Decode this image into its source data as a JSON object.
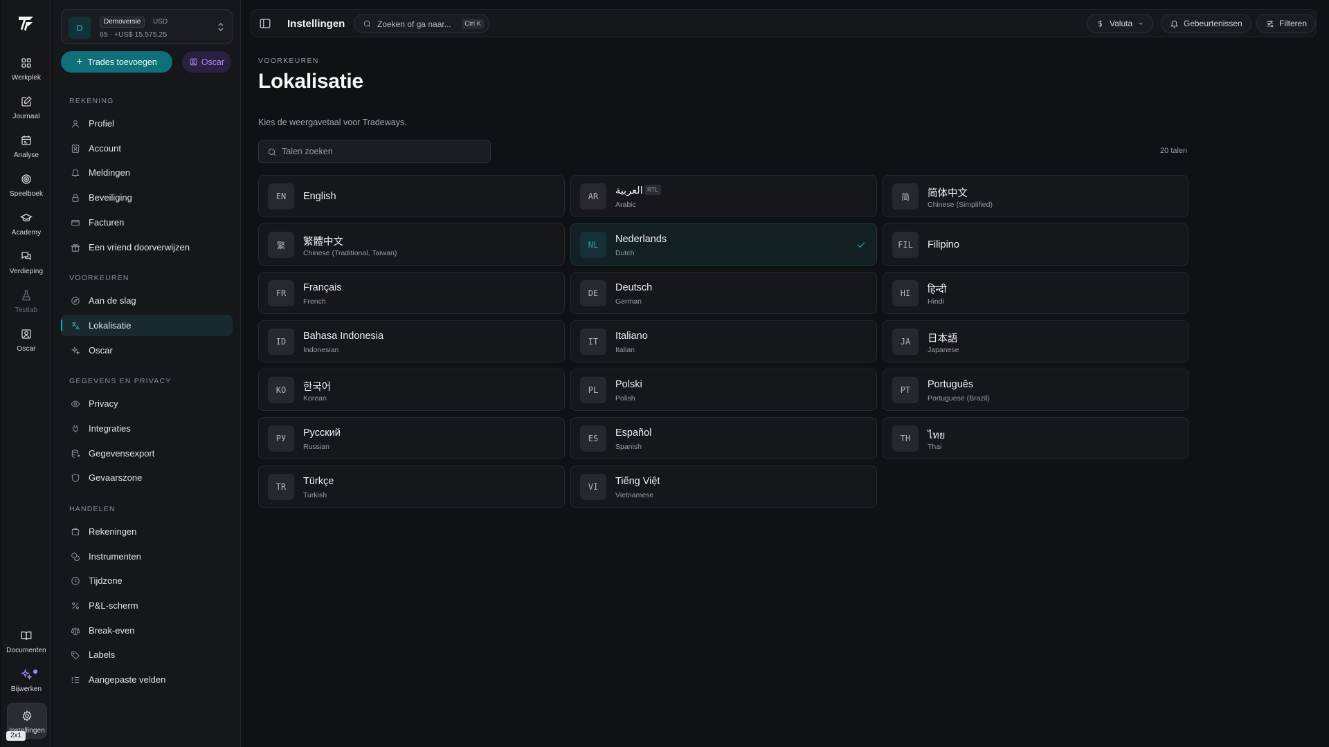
{
  "rail": {
    "items": [
      {
        "label": "Werkplek",
        "icon": "grid-icon"
      },
      {
        "label": "Journaal",
        "icon": "journal-edit-icon"
      },
      {
        "label": "Analyse",
        "icon": "calendar-icon"
      },
      {
        "label": "Speelboek",
        "icon": "target-icon"
      },
      {
        "label": "Academy",
        "icon": "graduation-cap-icon"
      },
      {
        "label": "Verdieping",
        "icon": "chat-bubbles-icon"
      },
      {
        "label": "Testlab",
        "icon": "flask-icon"
      },
      {
        "label": "Oscar",
        "icon": "user-square-icon"
      }
    ],
    "bottom": [
      {
        "label": "Documenten",
        "icon": "book-open-icon"
      },
      {
        "label": "Bijwerken",
        "icon": "sparkles-icon"
      },
      {
        "label": "Instellingen",
        "icon": "gear-icon"
      }
    ],
    "zoom_tag": "2x1"
  },
  "account": {
    "avatar": "D",
    "badge": "Demoversie",
    "currency": "USD",
    "balance": "65 · +US$ 15.575,25"
  },
  "actions": {
    "add_trades": "Trades toevoegen",
    "oscar": "Oscar"
  },
  "sidebar": {
    "sections": [
      {
        "title": "REKENING",
        "items": [
          "Profiel",
          "Account",
          "Meldingen",
          "Beveiliging",
          "Facturen",
          "Een vriend doorverwijzen"
        ]
      },
      {
        "title": "VOORKEUREN",
        "items": [
          "Aan de slag",
          "Lokalisatie",
          "Oscar"
        ]
      },
      {
        "title": "GEGEVENS EN PRIVACY",
        "items": [
          "Privacy",
          "Integraties",
          "Gegevensexport",
          "Gevaarszone"
        ]
      },
      {
        "title": "HANDELEN",
        "items": [
          "Rekeningen",
          "Instrumenten",
          "Tijdzone",
          "P&L-scherm",
          "Break-even",
          "Labels",
          "Aangepaste velden"
        ]
      }
    ],
    "active": "Lokalisatie"
  },
  "topbar": {
    "title": "Instellingen",
    "search_placeholder": "Zoeken of ga naar...",
    "shortcut": "Ctrl K",
    "currency_button": "Valuta",
    "events_button": "Gebeurtenissen",
    "filter_button": "Filteren"
  },
  "page": {
    "eyebrow": "VOORKEUREN",
    "title": "Lokalisatie",
    "description": "Kies de weergavetaal voor Tradeways.",
    "search_placeholder": "Talen zoeken",
    "count": "20 talen"
  },
  "languages": [
    {
      "code": "EN",
      "native": "English",
      "english": ""
    },
    {
      "code": "AR",
      "native": "العربية",
      "english": "Arabic",
      "rtl": "RTL"
    },
    {
      "code": "简",
      "native": "简体中文",
      "english": "Chinese (Simplified)"
    },
    {
      "code": "繁",
      "native": "繁體中文",
      "english": "Chinese (Traditional, Taiwan)"
    },
    {
      "code": "NL",
      "native": "Nederlands",
      "english": "Dutch",
      "selected": true
    },
    {
      "code": "FIL",
      "native": "Filipino",
      "english": ""
    },
    {
      "code": "FR",
      "native": "Français",
      "english": "French"
    },
    {
      "code": "DE",
      "native": "Deutsch",
      "english": "German"
    },
    {
      "code": "HI",
      "native": "हिन्दी",
      "english": "Hindi"
    },
    {
      "code": "ID",
      "native": "Bahasa Indonesia",
      "english": "Indonesian"
    },
    {
      "code": "IT",
      "native": "Italiano",
      "english": "Italian"
    },
    {
      "code": "JA",
      "native": "日本語",
      "english": "Japanese"
    },
    {
      "code": "KO",
      "native": "한국어",
      "english": "Korean"
    },
    {
      "code": "PL",
      "native": "Polski",
      "english": "Polish"
    },
    {
      "code": "PT",
      "native": "Português",
      "english": "Portuguese (Brazil)"
    },
    {
      "code": "РУ",
      "native": "Русский",
      "english": "Russian"
    },
    {
      "code": "ES",
      "native": "Español",
      "english": "Spanish"
    },
    {
      "code": "TH",
      "native": "ไทย",
      "english": "Thai"
    },
    {
      "code": "TR",
      "native": "Türkçe",
      "english": "Turkish"
    },
    {
      "code": "VI",
      "native": "Tiếng Việt",
      "english": "Vietnamese"
    }
  ],
  "colors": {
    "accent": "#0f6f7a",
    "accent_text": "#2e9eb2",
    "oscar": "#a78bfa",
    "background": "#101114"
  }
}
